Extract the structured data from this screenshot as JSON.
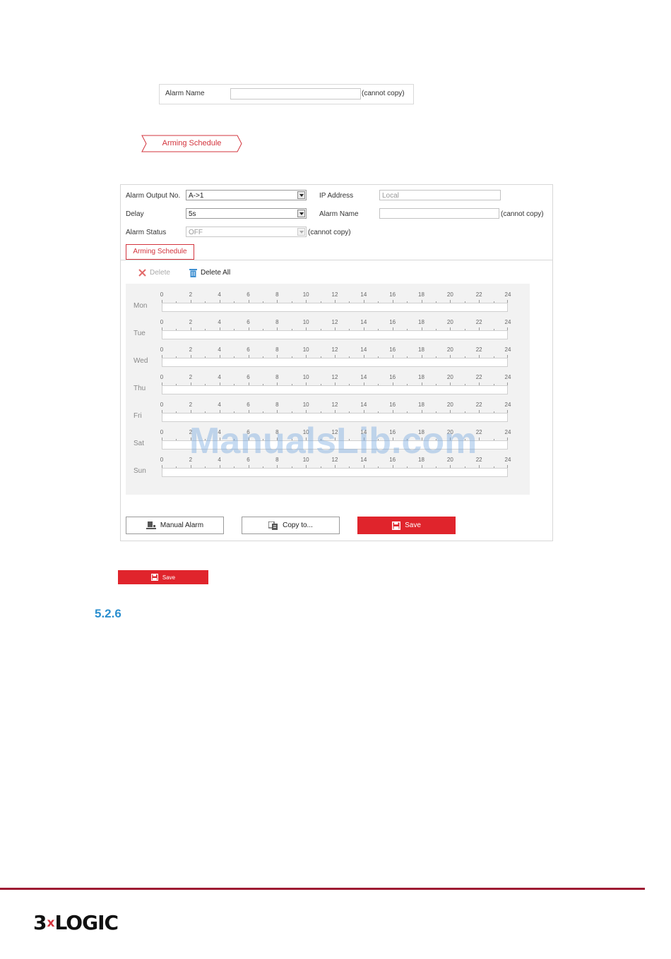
{
  "mini_alarm_name": {
    "label": "Alarm Name",
    "value": "",
    "note": "(cannot copy)"
  },
  "arrow_tag": {
    "label": "Arming Schedule"
  },
  "form": {
    "alarm_output_no": {
      "label": "Alarm Output No.",
      "value": "A->1"
    },
    "delay": {
      "label": "Delay",
      "value": "5s"
    },
    "alarm_status": {
      "label": "Alarm Status",
      "value": "OFF",
      "note": "(cannot copy)"
    },
    "ip_address": {
      "label": "IP Address",
      "placeholder": "Local"
    },
    "alarm_name": {
      "label": "Alarm Name",
      "value": "",
      "note": "(cannot copy)"
    }
  },
  "tab": {
    "label": "Arming Schedule"
  },
  "toolbar": {
    "delete_label": "Delete",
    "delete_all_label": "Delete All"
  },
  "schedule": {
    "days": [
      "Mon",
      "Tue",
      "Wed",
      "Thu",
      "Fri",
      "Sat",
      "Sun"
    ],
    "hour_labels": [
      "0",
      "2",
      "4",
      "6",
      "8",
      "10",
      "12",
      "14",
      "16",
      "18",
      "20",
      "22",
      "24"
    ]
  },
  "buttons": {
    "manual_alarm": "Manual Alarm",
    "copy_to": "Copy to...",
    "save": "Save"
  },
  "small_save": {
    "label": "Save"
  },
  "section_number": "5.2.6",
  "watermark": "ManualsLib.com",
  "logo": {
    "part1": "3",
    "x": "x",
    "part2": "LOGIC"
  },
  "colors": {
    "accent_red": "#e0242c",
    "section_blue": "#2b8fcf",
    "footer_line": "#9e1b32"
  }
}
